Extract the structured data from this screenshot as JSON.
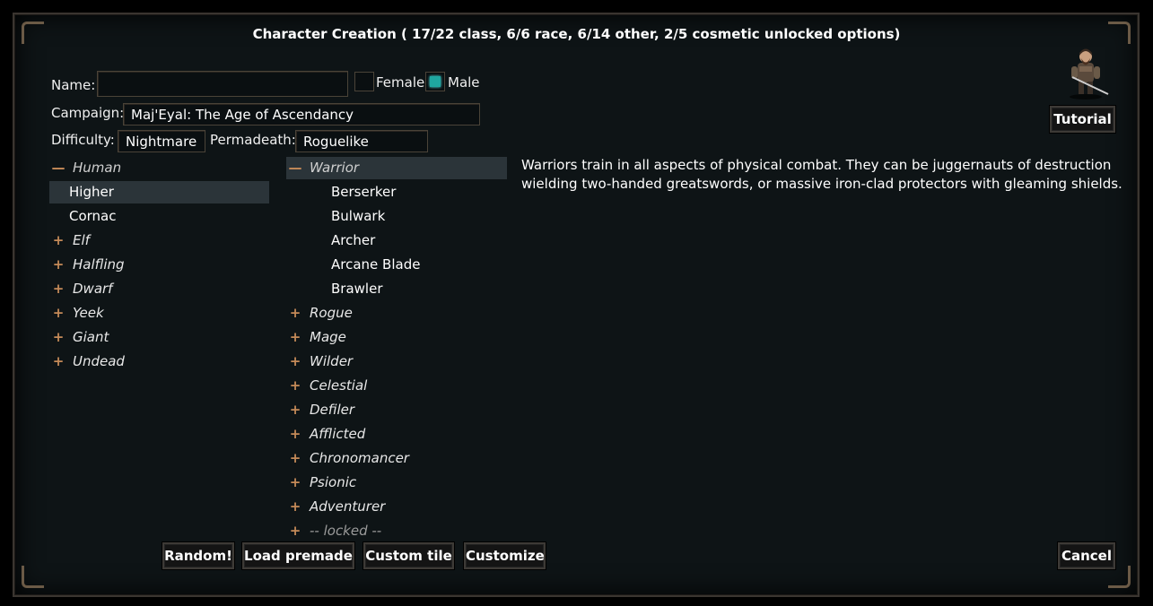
{
  "window": {
    "title": "Character Creation ( 17/22 class, 6/6 race, 6/14 other, 2/5 cosmetic unlocked options)"
  },
  "form": {
    "name_label": "Name:",
    "name_value": "",
    "female_label": "Female",
    "male_label": "Male",
    "female_checked": false,
    "male_checked": true,
    "campaign_label": "Campaign:",
    "campaign_value": "Maj'Eyal: The Age of Ascendancy",
    "difficulty_label": "Difficulty:",
    "difficulty_value": "Nightmare",
    "permadeath_label": "Permadeath:",
    "permadeath_value": "Roguelike"
  },
  "races": [
    {
      "label": "Human",
      "expander": "—",
      "type": "category"
    },
    {
      "label": "Higher",
      "type": "item",
      "selected": true
    },
    {
      "label": "Cornac",
      "type": "item"
    },
    {
      "label": "Elf",
      "expander": "+",
      "type": "category"
    },
    {
      "label": "Halfling",
      "expander": "+",
      "type": "category"
    },
    {
      "label": "Dwarf",
      "expander": "+",
      "type": "category"
    },
    {
      "label": "Yeek",
      "expander": "+",
      "type": "category"
    },
    {
      "label": "Giant",
      "expander": "+",
      "type": "category"
    },
    {
      "label": "Undead",
      "expander": "+",
      "type": "category"
    }
  ],
  "classes": [
    {
      "label": "Warrior",
      "expander": "—",
      "type": "category",
      "selected": true
    },
    {
      "label": "Berserker",
      "type": "item"
    },
    {
      "label": "Bulwark",
      "type": "item"
    },
    {
      "label": "Archer",
      "type": "item"
    },
    {
      "label": "Arcane Blade",
      "type": "item"
    },
    {
      "label": "Brawler",
      "type": "item"
    },
    {
      "label": "Rogue",
      "expander": "+",
      "type": "category"
    },
    {
      "label": "Mage",
      "expander": "+",
      "type": "category"
    },
    {
      "label": "Wilder",
      "expander": "+",
      "type": "category"
    },
    {
      "label": "Celestial",
      "expander": "+",
      "type": "category"
    },
    {
      "label": "Defiler",
      "expander": "+",
      "type": "category"
    },
    {
      "label": "Afflicted",
      "expander": "+",
      "type": "category"
    },
    {
      "label": "Chronomancer",
      "expander": "+",
      "type": "category"
    },
    {
      "label": "Psionic",
      "expander": "+",
      "type": "category"
    },
    {
      "label": "Adventurer",
      "expander": "+",
      "type": "category"
    },
    {
      "label": "-- locked --",
      "expander": "+",
      "type": "locked"
    }
  ],
  "description": "Warriors train in all aspects of physical combat. They can be juggernauts of destruction wielding two-handed greatswords, or massive iron-clad protectors with gleaming shields.",
  "buttons": {
    "tutorial": "Tutorial",
    "random": "Random!",
    "load_premade": "Load premade",
    "custom_tile": "Custom tile",
    "customize": "Customize",
    "cancel": "Cancel"
  },
  "colors": {
    "background": "#0e1416",
    "selection": "#2b3439",
    "expander": "#c58a58",
    "checked": "#1fa7a0"
  },
  "icons": {
    "avatar": "warrior-avatar-icon",
    "expand": "plus-icon",
    "collapse": "minus-icon"
  }
}
